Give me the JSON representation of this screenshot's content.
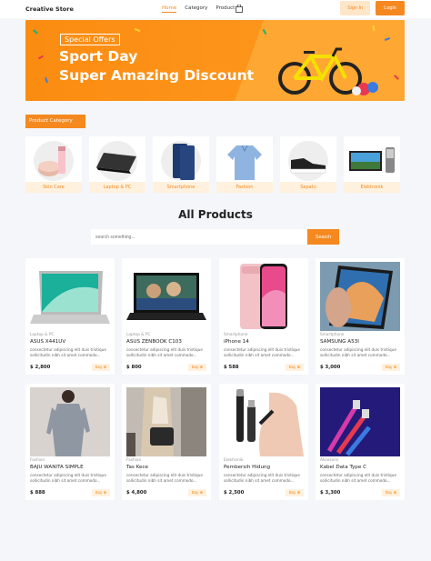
{
  "nav": {
    "brand": "Creative Store",
    "items": [
      "Home",
      "Category",
      "Product"
    ],
    "signin": "Sign In",
    "login": "Login"
  },
  "hero": {
    "tag": "Special Offers",
    "line1": "Sport Day",
    "line2": "Super Amazing Discount"
  },
  "category": {
    "label": "Product Category",
    "items": [
      "Skin Care",
      "Laptop & PC",
      "Smartphone",
      "Fashion",
      "Sepatu",
      "Elektronik"
    ]
  },
  "products_section": {
    "title": "All Products",
    "search_placeholder": "search something...",
    "search_button": "Search",
    "buy_label": "Buy"
  },
  "products": [
    {
      "category": "Laptop & PC",
      "name": "ASUS X441UV",
      "desc": "consectetur adipiscing elit duis tristique sollicitudin nibh sit amet commodo...",
      "price": "$ 2,800"
    },
    {
      "category": "Laptop & PC",
      "name": "ASUS ZENBOOK C103",
      "desc": "consectetur adipiscing elit duis tristique sollicitudin nibh sit amet commodo...",
      "price": "$ 800"
    },
    {
      "category": "Smartphone",
      "name": "iPhone 14",
      "desc": "consectetur adipiscing elit duis tristique sollicitudin nibh sit amet commodo...",
      "price": "$ 588"
    },
    {
      "category": "Smartphone",
      "name": "SAMSUNG A53I",
      "desc": "consectetur adipiscing elit duis tristique sollicitudin nibh sit amet commodo...",
      "price": "$ 3,000"
    },
    {
      "category": "Fashion",
      "name": "BAJU WANITA SIMPLE",
      "desc": "consectetur adipiscing elit duis tristique sollicitudin nibh sit amet commodo...",
      "price": "$ 888"
    },
    {
      "category": "Fashion",
      "name": "Tas Kece",
      "desc": "consectetur adipiscing elit duis tristique sollicitudin nibh sit amet commodo...",
      "price": "$ 4,800"
    },
    {
      "category": "Elektronik",
      "name": "Pembersih Hidung",
      "desc": "consectetur adipiscing elit duis tristique sollicitudin nibh sit amet commodo...",
      "price": "$ 2,500"
    },
    {
      "category": "Aksesoris",
      "name": "Kabel Data Type C",
      "desc": "consectetur adipiscing elit duis tristique sollicitudin nibh sit amet commodo...",
      "price": "$ 3,300"
    }
  ],
  "colors": {
    "accent": "#f5891f",
    "accent_light": "#fff1dd"
  }
}
